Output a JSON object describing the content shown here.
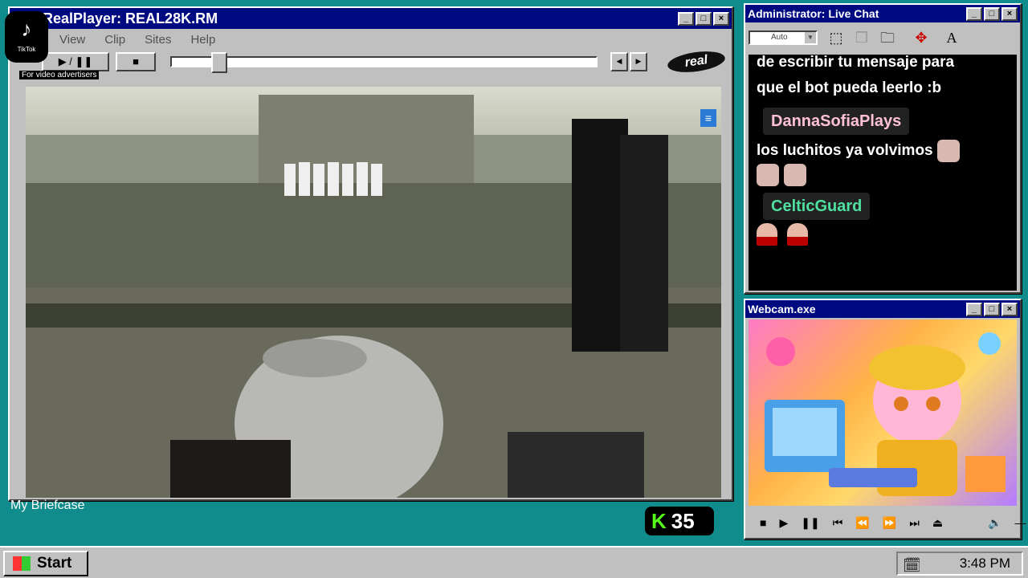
{
  "player": {
    "title": "RealPlayer: REAL28K.RM",
    "menu": [
      "View",
      "Clip",
      "Sites",
      "Help"
    ],
    "play_pause_label": "▶ / ❚❚",
    "stop_label": "■",
    "prev_label": "◀",
    "next_label": "▶",
    "logo": "real",
    "overlay_ad": "For video advertisers",
    "tiktok_label": "TikTok",
    "progress_fraction": 0.1
  },
  "chat": {
    "title": "Administrator: Live Chat",
    "auto_label": "Auto",
    "font_icon": "A",
    "lines": [
      {
        "type": "text",
        "text": "de escribir tu mensaje para"
      },
      {
        "type": "text",
        "text": "que el bot pueda leerlo :b"
      }
    ],
    "user1": "DannaSofiaPlays",
    "user1_msg": "los luchitos ya volvimos",
    "user2": "CelticGuard"
  },
  "webcam": {
    "title": "Webcam.exe",
    "controls": [
      "■",
      "▶",
      "❚❚",
      "⏮",
      "⏪",
      "⏩",
      "⏭",
      "⏏"
    ]
  },
  "desktop": {
    "briefcase_label": "My Briefcase",
    "kick_count": "35",
    "kick_icon": "K"
  },
  "taskbar": {
    "start_label": "Start",
    "clock": "3:48 PM"
  }
}
